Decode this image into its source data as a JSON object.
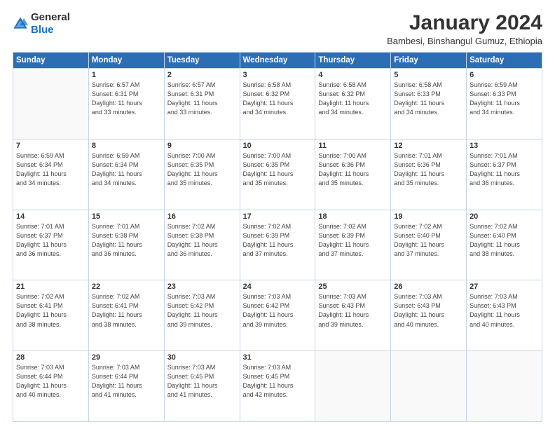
{
  "logo": {
    "general": "General",
    "blue": "Blue"
  },
  "header": {
    "month": "January 2024",
    "location": "Bambesi, Binshangul Gumuz, Ethiopia"
  },
  "days": [
    "Sunday",
    "Monday",
    "Tuesday",
    "Wednesday",
    "Thursday",
    "Friday",
    "Saturday"
  ],
  "weeks": [
    [
      {
        "day": "",
        "info": ""
      },
      {
        "day": "1",
        "info": "Sunrise: 6:57 AM\nSunset: 6:31 PM\nDaylight: 11 hours\nand 33 minutes."
      },
      {
        "day": "2",
        "info": "Sunrise: 6:57 AM\nSunset: 6:31 PM\nDaylight: 11 hours\nand 33 minutes."
      },
      {
        "day": "3",
        "info": "Sunrise: 6:58 AM\nSunset: 6:32 PM\nDaylight: 11 hours\nand 34 minutes."
      },
      {
        "day": "4",
        "info": "Sunrise: 6:58 AM\nSunset: 6:32 PM\nDaylight: 11 hours\nand 34 minutes."
      },
      {
        "day": "5",
        "info": "Sunrise: 6:58 AM\nSunset: 6:33 PM\nDaylight: 11 hours\nand 34 minutes."
      },
      {
        "day": "6",
        "info": "Sunrise: 6:59 AM\nSunset: 6:33 PM\nDaylight: 11 hours\nand 34 minutes."
      }
    ],
    [
      {
        "day": "7",
        "info": "Sunrise: 6:59 AM\nSunset: 6:34 PM\nDaylight: 11 hours\nand 34 minutes."
      },
      {
        "day": "8",
        "info": "Sunrise: 6:59 AM\nSunset: 6:34 PM\nDaylight: 11 hours\nand 34 minutes."
      },
      {
        "day": "9",
        "info": "Sunrise: 7:00 AM\nSunset: 6:35 PM\nDaylight: 11 hours\nand 35 minutes."
      },
      {
        "day": "10",
        "info": "Sunrise: 7:00 AM\nSunset: 6:35 PM\nDaylight: 11 hours\nand 35 minutes."
      },
      {
        "day": "11",
        "info": "Sunrise: 7:00 AM\nSunset: 6:36 PM\nDaylight: 11 hours\nand 35 minutes."
      },
      {
        "day": "12",
        "info": "Sunrise: 7:01 AM\nSunset: 6:36 PM\nDaylight: 11 hours\nand 35 minutes."
      },
      {
        "day": "13",
        "info": "Sunrise: 7:01 AM\nSunset: 6:37 PM\nDaylight: 11 hours\nand 36 minutes."
      }
    ],
    [
      {
        "day": "14",
        "info": "Sunrise: 7:01 AM\nSunset: 6:37 PM\nDaylight: 11 hours\nand 36 minutes."
      },
      {
        "day": "15",
        "info": "Sunrise: 7:01 AM\nSunset: 6:38 PM\nDaylight: 11 hours\nand 36 minutes."
      },
      {
        "day": "16",
        "info": "Sunrise: 7:02 AM\nSunset: 6:38 PM\nDaylight: 11 hours\nand 36 minutes."
      },
      {
        "day": "17",
        "info": "Sunrise: 7:02 AM\nSunset: 6:39 PM\nDaylight: 11 hours\nand 37 minutes."
      },
      {
        "day": "18",
        "info": "Sunrise: 7:02 AM\nSunset: 6:39 PM\nDaylight: 11 hours\nand 37 minutes."
      },
      {
        "day": "19",
        "info": "Sunrise: 7:02 AM\nSunset: 6:40 PM\nDaylight: 11 hours\nand 37 minutes."
      },
      {
        "day": "20",
        "info": "Sunrise: 7:02 AM\nSunset: 6:40 PM\nDaylight: 11 hours\nand 38 minutes."
      }
    ],
    [
      {
        "day": "21",
        "info": "Sunrise: 7:02 AM\nSunset: 6:41 PM\nDaylight: 11 hours\nand 38 minutes."
      },
      {
        "day": "22",
        "info": "Sunrise: 7:02 AM\nSunset: 6:41 PM\nDaylight: 11 hours\nand 38 minutes."
      },
      {
        "day": "23",
        "info": "Sunrise: 7:03 AM\nSunset: 6:42 PM\nDaylight: 11 hours\nand 39 minutes."
      },
      {
        "day": "24",
        "info": "Sunrise: 7:03 AM\nSunset: 6:42 PM\nDaylight: 11 hours\nand 39 minutes."
      },
      {
        "day": "25",
        "info": "Sunrise: 7:03 AM\nSunset: 6:43 PM\nDaylight: 11 hours\nand 39 minutes."
      },
      {
        "day": "26",
        "info": "Sunrise: 7:03 AM\nSunset: 6:43 PM\nDaylight: 11 hours\nand 40 minutes."
      },
      {
        "day": "27",
        "info": "Sunrise: 7:03 AM\nSunset: 6:43 PM\nDaylight: 11 hours\nand 40 minutes."
      }
    ],
    [
      {
        "day": "28",
        "info": "Sunrise: 7:03 AM\nSunset: 6:44 PM\nDaylight: 11 hours\nand 40 minutes."
      },
      {
        "day": "29",
        "info": "Sunrise: 7:03 AM\nSunset: 6:44 PM\nDaylight: 11 hours\nand 41 minutes."
      },
      {
        "day": "30",
        "info": "Sunrise: 7:03 AM\nSunset: 6:45 PM\nDaylight: 11 hours\nand 41 minutes."
      },
      {
        "day": "31",
        "info": "Sunrise: 7:03 AM\nSunset: 6:45 PM\nDaylight: 11 hours\nand 42 minutes."
      },
      {
        "day": "",
        "info": ""
      },
      {
        "day": "",
        "info": ""
      },
      {
        "day": "",
        "info": ""
      }
    ]
  ]
}
